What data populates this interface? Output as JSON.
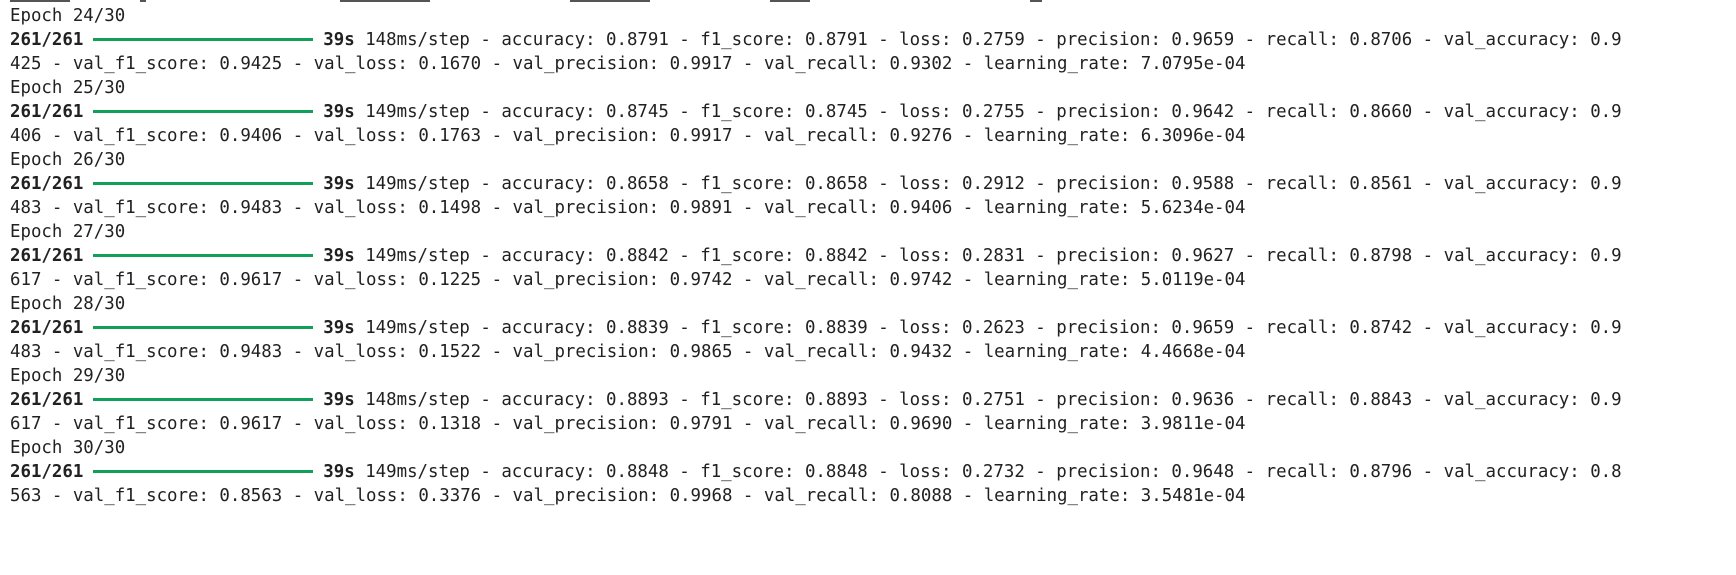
{
  "epochs": [
    {
      "header": "Epoch 24/30",
      "steps": "261/261",
      "time": "39s",
      "line1_rest": "148ms/step - accuracy: 0.8791 - f1_score: 0.8791 - loss: 0.2759 - precision: 0.9659 - recall: 0.8706 - val_accuracy: 0.9",
      "line2": "425 - val_f1_score: 0.9425 - val_loss: 0.1670 - val_precision: 0.9917 - val_recall: 0.9302 - learning_rate: 7.0795e-04"
    },
    {
      "header": "Epoch 25/30",
      "steps": "261/261",
      "time": "39s",
      "line1_rest": "149ms/step - accuracy: 0.8745 - f1_score: 0.8745 - loss: 0.2755 - precision: 0.9642 - recall: 0.8660 - val_accuracy: 0.9",
      "line2": "406 - val_f1_score: 0.9406 - val_loss: 0.1763 - val_precision: 0.9917 - val_recall: 0.9276 - learning_rate: 6.3096e-04"
    },
    {
      "header": "Epoch 26/30",
      "steps": "261/261",
      "time": "39s",
      "line1_rest": "149ms/step - accuracy: 0.8658 - f1_score: 0.8658 - loss: 0.2912 - precision: 0.9588 - recall: 0.8561 - val_accuracy: 0.9",
      "line2": "483 - val_f1_score: 0.9483 - val_loss: 0.1498 - val_precision: 0.9891 - val_recall: 0.9406 - learning_rate: 5.6234e-04"
    },
    {
      "header": "Epoch 27/30",
      "steps": "261/261",
      "time": "39s",
      "line1_rest": "149ms/step - accuracy: 0.8842 - f1_score: 0.8842 - loss: 0.2831 - precision: 0.9627 - recall: 0.8798 - val_accuracy: 0.9",
      "line2": "617 - val_f1_score: 0.9617 - val_loss: 0.1225 - val_precision: 0.9742 - val_recall: 0.9742 - learning_rate: 5.0119e-04"
    },
    {
      "header": "Epoch 28/30",
      "steps": "261/261",
      "time": "39s",
      "line1_rest": "149ms/step - accuracy: 0.8839 - f1_score: 0.8839 - loss: 0.2623 - precision: 0.9659 - recall: 0.8742 - val_accuracy: 0.9",
      "line2": "483 - val_f1_score: 0.9483 - val_loss: 0.1522 - val_precision: 0.9865 - val_recall: 0.9432 - learning_rate: 4.4668e-04"
    },
    {
      "header": "Epoch 29/30",
      "steps": "261/261",
      "time": "39s",
      "line1_rest": "148ms/step - accuracy: 0.8893 - f1_score: 0.8893 - loss: 0.2751 - precision: 0.9636 - recall: 0.8843 - val_accuracy: 0.9",
      "line2": "617 - val_f1_score: 0.9617 - val_loss: 0.1318 - val_precision: 0.9791 - val_recall: 0.9690 - learning_rate: 3.9811e-04"
    },
    {
      "header": "Epoch 30/30",
      "steps": "261/261",
      "time": "39s",
      "line1_rest": "149ms/step - accuracy: 0.8848 - f1_score: 0.8848 - loss: 0.2732 - precision: 0.9648 - recall: 0.8796 - val_accuracy: 0.8",
      "line2": "563 - val_f1_score: 0.8563 - val_loss: 0.3376 - val_precision: 0.9968 - val_recall: 0.8088 - learning_rate: 3.5481e-04"
    }
  ],
  "colors": {
    "text": "#212121",
    "progress_bar": "#10a05a",
    "background": "#ffffff"
  }
}
